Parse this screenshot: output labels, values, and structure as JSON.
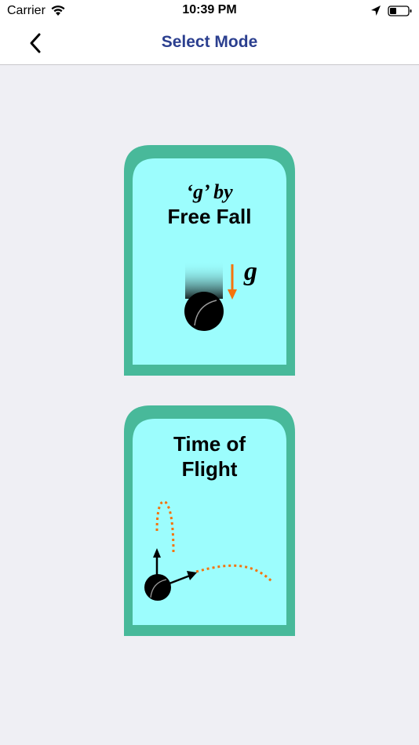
{
  "status_bar": {
    "carrier": "Carrier",
    "time": "10:39 PM",
    "icons": [
      "wifi-icon",
      "location-arrow-icon",
      "battery-icon"
    ]
  },
  "nav": {
    "back_icon": "chevron-left-icon",
    "title": "Select Mode"
  },
  "modes": [
    {
      "title_line1": "‘g’ by",
      "title_line2": "Free Fall",
      "symbol": "g"
    },
    {
      "title_line1": "Time of",
      "title_line2": "Flight"
    }
  ],
  "colors": {
    "card_border": "#48b99a",
    "card_fill": "#9cfdfd",
    "arrow_orange": "#f5730c",
    "title_blue": "#2b3f8f",
    "background": "#efeff4"
  }
}
